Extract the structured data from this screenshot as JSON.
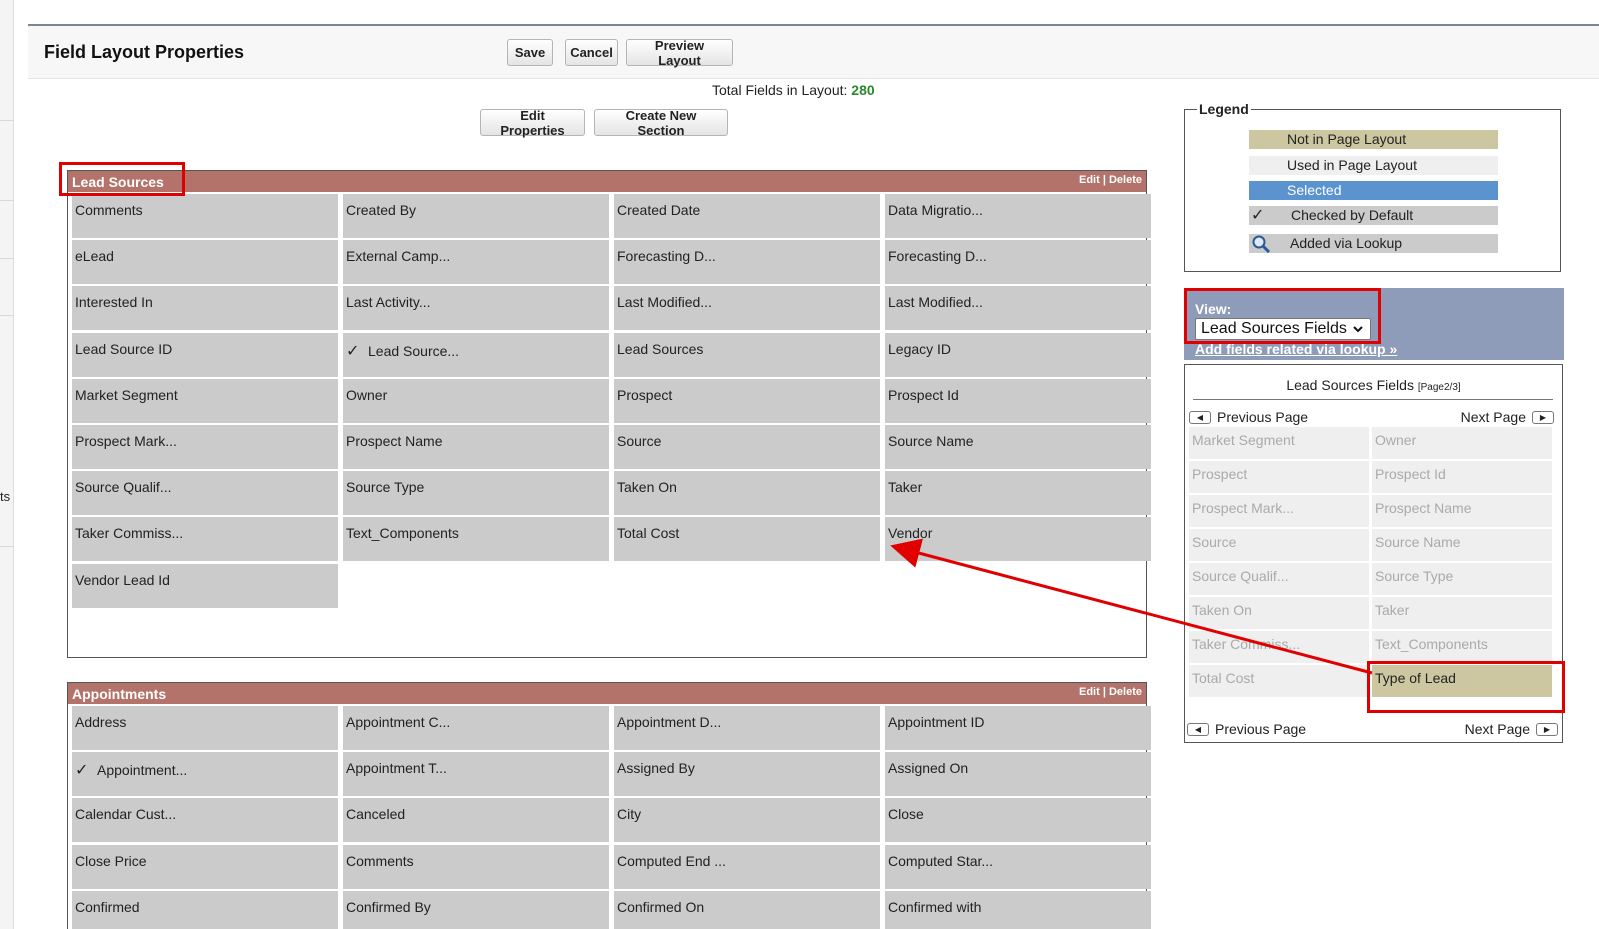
{
  "side_stub": {
    "text": "ts"
  },
  "header": {
    "title": "Field Layout Properties",
    "save_label": "Save",
    "cancel_label": "Cancel",
    "preview_label": "Preview Layout"
  },
  "summary": {
    "label": "Total Fields in Layout:",
    "count": "280"
  },
  "actions": {
    "edit_props": "Edit Properties",
    "new_section": "Create New Section"
  },
  "sections": [
    {
      "title": "Lead Sources",
      "edit": "Edit",
      "sep": "|",
      "delete": "Delete",
      "fields": [
        "Comments",
        "Created By",
        "Created Date",
        "Data Migratio...",
        "eLead",
        "External Camp...",
        "Forecasting D...",
        "Forecasting D...",
        "Interested In",
        "Last Activity...",
        "Last Modified...",
        "Last Modified...",
        "Lead Source ID",
        "Lead Source...",
        "Lead Sources",
        "Legacy ID",
        "Market Segment",
        "Owner",
        "Prospect",
        "Prospect Id",
        "Prospect Mark...",
        "Prospect Name",
        "Source",
        "Source Name",
        "Source Qualif...",
        "Source Type",
        "Taken On",
        "Taker",
        "Taker Commiss...",
        "Text_Components",
        "Total Cost",
        "Vendor",
        "Vendor Lead Id"
      ]
    },
    {
      "title": "Appointments",
      "edit": "Edit",
      "sep": "|",
      "delete": "Delete",
      "fields": [
        "Address",
        "Appointment C...",
        "Appointment D...",
        "Appointment ID",
        "Appointment...",
        "Appointment T...",
        "Assigned By",
        "Assigned On",
        "Calendar Cust...",
        "Canceled",
        "City",
        "Close",
        "Close Price",
        "Comments",
        "Computed End ...",
        "Computed Star...",
        "Confirmed",
        "Confirmed By",
        "Confirmed On",
        "Confirmed with"
      ]
    }
  ],
  "legend": {
    "title": "Legend",
    "items": [
      "Not in Page Layout",
      "Used in Page Layout",
      "Selected",
      "Checked by Default",
      "Added via Lookup"
    ],
    "colors": {
      "not_in_layout": "#ccc7a0",
      "used": "#efefef",
      "selected": "#5b93cf",
      "default": "#cbcbcb"
    }
  },
  "view": {
    "label": "View:",
    "selected": "Lead Sources Fields",
    "lookup_link": "Add fields related via lookup »"
  },
  "palette": {
    "title": "Lead Sources Fields",
    "page": "[Page2/3]",
    "prev": "Previous Page",
    "next": "Next Page",
    "fields": [
      "Market Segment",
      "Owner",
      "Prospect",
      "Prospect Id",
      "Prospect Mark...",
      "Prospect Name",
      "Source",
      "Source Name",
      "Source Qualif...",
      "Source Type",
      "Taken On",
      "Taker",
      "Taker Commiss...",
      "Text_Components",
      "Total Cost",
      "Type of Lead"
    ]
  },
  "accent_colors": {
    "section_header": "#b3736a",
    "view_bg": "#8e9bb9",
    "highlight": "#e00000",
    "count": "#2a8a2a"
  }
}
